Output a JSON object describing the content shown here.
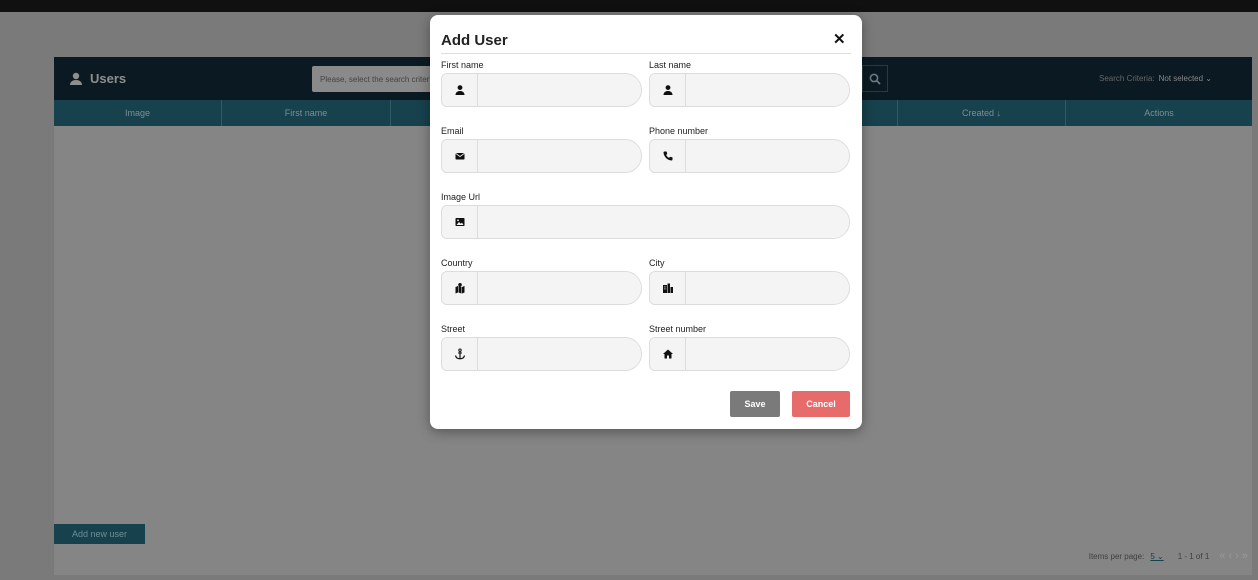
{
  "panel": {
    "title": "Users",
    "title_icon": "user-icon",
    "search_placeholder": "Please, select the search criteria",
    "search_criteria_label": "Search Criteria:",
    "search_criteria_value": "Not selected ⌄",
    "columns": [
      "Image",
      "First name",
      "",
      "",
      "",
      "Created ↓",
      "Actions"
    ],
    "add_button": "Add new user",
    "pager": {
      "items_per_page_label": "Items per page:",
      "items_per_page_value": "5 ⌄",
      "range": "1 - 1 of 1",
      "nav": "«  ‹  ›  »"
    }
  },
  "modal": {
    "title": "Add User",
    "close": "✕",
    "fields": {
      "first_name": {
        "label": "First name",
        "icon": "user-icon",
        "value": ""
      },
      "last_name": {
        "label": "Last name",
        "icon": "user-icon",
        "value": ""
      },
      "email": {
        "label": "Email",
        "icon": "envelope-icon",
        "value": ""
      },
      "phone": {
        "label": "Phone number",
        "icon": "phone-icon",
        "value": ""
      },
      "image_url": {
        "label": "Image Url",
        "icon": "image-icon",
        "value": ""
      },
      "country": {
        "label": "Country",
        "icon": "map-icon",
        "value": ""
      },
      "city": {
        "label": "City",
        "icon": "city-icon",
        "value": ""
      },
      "street": {
        "label": "Street",
        "icon": "anchor-icon",
        "value": ""
      },
      "street_number": {
        "label": "Street number",
        "icon": "home-icon",
        "value": ""
      }
    },
    "save": "Save",
    "cancel": "Cancel"
  },
  "colors": {
    "overlay": "#7a7a7a",
    "header": "#0b1a22",
    "table_header": "#17414d",
    "save": "#7a7a7a",
    "cancel": "#e76b6b"
  }
}
